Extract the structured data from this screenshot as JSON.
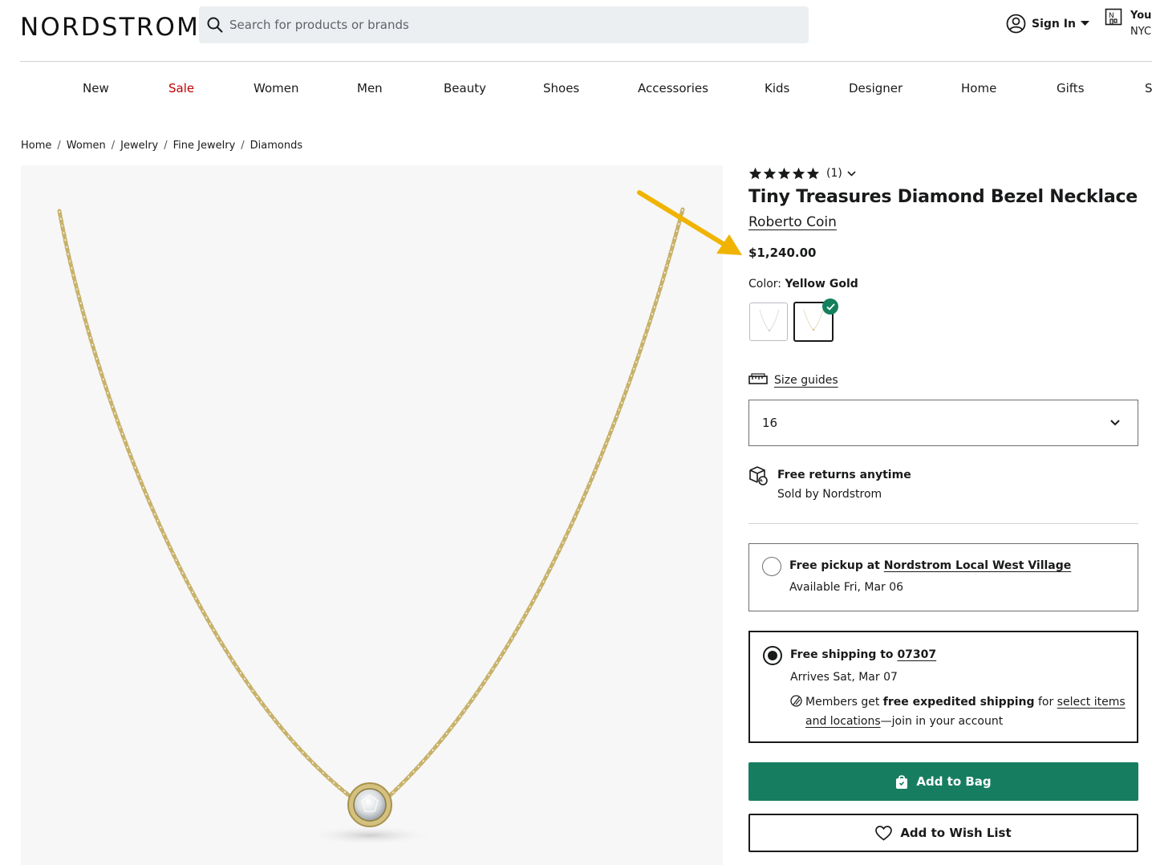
{
  "header": {
    "logo": "NORDSTROM",
    "search_placeholder": "Search for products or brands",
    "sign_in": "Sign In",
    "store_line1": "Your",
    "store_line2": "NYC"
  },
  "nav": {
    "items": [
      "New",
      "Sale",
      "Women",
      "Men",
      "Beauty",
      "Shoes",
      "Accessories",
      "Kids",
      "Designer",
      "Home",
      "Gifts",
      "S"
    ]
  },
  "breadcrumb": [
    "Home",
    "Women",
    "Jewelry",
    "Fine Jewelry",
    "Diamonds"
  ],
  "product": {
    "rating_stars": 5,
    "rating_count": "(1)",
    "title": "Tiny Treasures Diamond Bezel Necklace",
    "brand": "Roberto Coin",
    "price": "$1,240.00",
    "color_label": "Color:",
    "color_value": "Yellow Gold",
    "size_guides": "Size guides",
    "selected_size": "16",
    "returns_title": "Free returns anytime",
    "sold_by": "Sold by Nordstrom"
  },
  "fulfillment": {
    "pickup_prefix": "Free pickup at",
    "pickup_store": "Nordstrom Local West Village",
    "pickup_available": "Available Fri, Mar 06",
    "ship_prefix": "Free shipping to",
    "ship_zip": "07307",
    "ship_arrives": "Arrives Sat, Mar 07",
    "member_text_1": "Members get",
    "member_bold": "free expedited shipping",
    "member_text_2": "for",
    "member_link_1": "select items",
    "member_link_2": "and locations",
    "member_text_3": "—join in your account"
  },
  "buttons": {
    "add_to_bag": "Add to Bag",
    "add_to_wish_list": "Add to Wish List"
  },
  "colors": {
    "accent_green": "#177d60",
    "sale_red": "#c00000",
    "annotation_arrow": "#f0b400",
    "chain_gold": "#c8b26a"
  }
}
